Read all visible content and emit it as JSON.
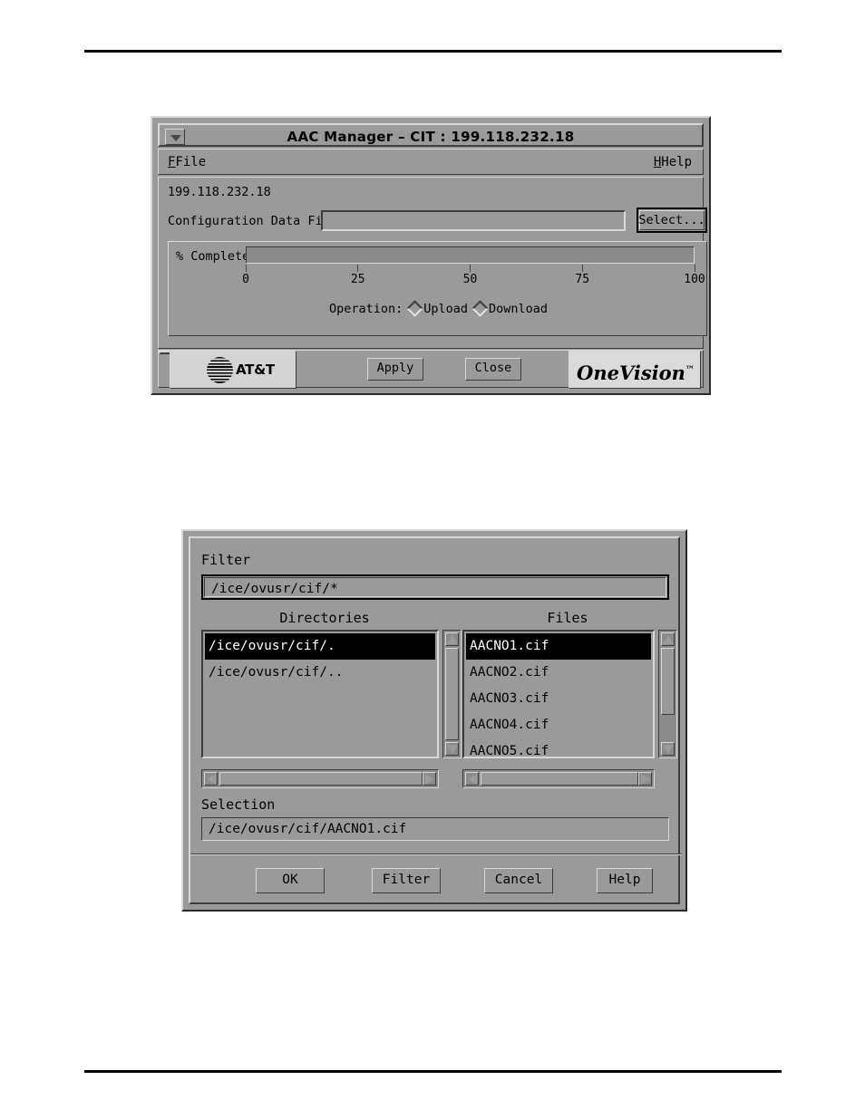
{
  "page": {
    "rule_top": true,
    "rule_bottom": true
  },
  "aac_manager": {
    "title": "AAC Manager – CIT : 199.118.232.18",
    "window_menu_icon": "window-menu-triangle-icon",
    "menubar": {
      "file": {
        "label": "File",
        "mnemonic": "F"
      },
      "help": {
        "label": "Help",
        "mnemonic": "H"
      }
    },
    "host_address": "199.118.232.18",
    "config_file": {
      "label": "Configuration Data File:",
      "value": "",
      "placeholder": ""
    },
    "select_button": "Select...",
    "progress": {
      "label": "% Complete",
      "percent": 0,
      "ticks": [
        "0",
        "25",
        "50",
        "75",
        "100"
      ],
      "tick_values": [
        0,
        25,
        50,
        75,
        100
      ]
    },
    "operation": {
      "label": "Operation:",
      "options": [
        "Upload",
        "Download"
      ],
      "selected": ""
    },
    "att_logo": {
      "text": "AT&T",
      "icon": "att-globe-icon"
    },
    "onevision_logo": {
      "text": "OneVision",
      "trademark": "™"
    },
    "buttons": {
      "apply": "Apply",
      "close": "Close"
    }
  },
  "file_selection": {
    "filter_label": "Filter",
    "filter_value": "/ice/ovusr/cif/*",
    "directories_label": "Directories",
    "files_label": "Files",
    "directories": [
      "/ice/ovusr/cif/.",
      "/ice/ovusr/cif/.."
    ],
    "directories_selected_index": 0,
    "files": [
      "AACNO1.cif",
      "AACNO2.cif",
      "AACNO3.cif",
      "AACNO4.cif",
      "AACNO5.cif"
    ],
    "files_selected_index": 0,
    "selection_label": "Selection",
    "selection_value": "/ice/ovusr/cif/AACNO1.cif",
    "buttons": {
      "ok": "OK",
      "filter": "Filter",
      "cancel": "Cancel",
      "help": "Help"
    }
  },
  "colors": {
    "motif_face": "#9a9a9a",
    "bevel_light": "#d8d8d8",
    "bevel_dark": "#3d3d3d",
    "selection_bg": "#000000",
    "selection_fg": "#ffffff",
    "logo_face": "#d4d4d4"
  }
}
